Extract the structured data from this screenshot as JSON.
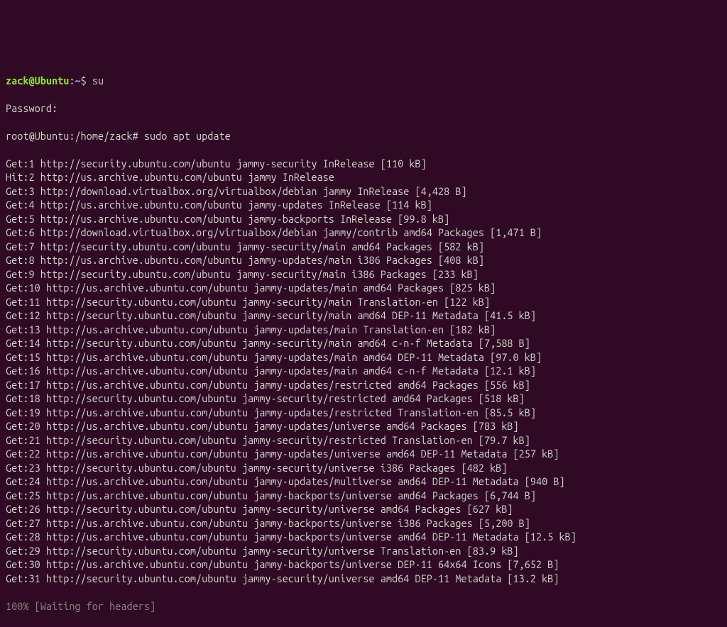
{
  "prompt1": {
    "user": "zack",
    "at": "@",
    "host": "Ubuntu",
    "colon": ":",
    "path": "~",
    "symbol": "$",
    "command": "su"
  },
  "password_prompt": "Password:",
  "prompt2": {
    "text": "root@Ubuntu:/home/zack#",
    "command": "sudo apt update"
  },
  "output_lines": [
    "Get:1 http://security.ubuntu.com/ubuntu jammy-security InRelease [110 kB]",
    "Hit:2 http://us.archive.ubuntu.com/ubuntu jammy InRelease",
    "Get:3 http://download.virtualbox.org/virtualbox/debian jammy InRelease [4,428 B]",
    "Get:4 http://us.archive.ubuntu.com/ubuntu jammy-updates InRelease [114 kB]",
    "Get:5 http://us.archive.ubuntu.com/ubuntu jammy-backports InRelease [99.8 kB]",
    "Get:6 http://download.virtualbox.org/virtualbox/debian jammy/contrib amd64 Packages [1,471 B]",
    "Get:7 http://security.ubuntu.com/ubuntu jammy-security/main amd64 Packages [582 kB]",
    "Get:8 http://us.archive.ubuntu.com/ubuntu jammy-updates/main i386 Packages [408 kB]",
    "Get:9 http://security.ubuntu.com/ubuntu jammy-security/main i386 Packages [233 kB]",
    "Get:10 http://us.archive.ubuntu.com/ubuntu jammy-updates/main amd64 Packages [825 kB]",
    "Get:11 http://security.ubuntu.com/ubuntu jammy-security/main Translation-en [122 kB]",
    "Get:12 http://security.ubuntu.com/ubuntu jammy-security/main amd64 DEP-11 Metadata [41.5 kB]",
    "Get:13 http://us.archive.ubuntu.com/ubuntu jammy-updates/main Translation-en [182 kB]",
    "Get:14 http://security.ubuntu.com/ubuntu jammy-security/main amd64 c-n-f Metadata [7,588 B]",
    "Get:15 http://us.archive.ubuntu.com/ubuntu jammy-updates/main amd64 DEP-11 Metadata [97.0 kB]",
    "Get:16 http://us.archive.ubuntu.com/ubuntu jammy-updates/main amd64 c-n-f Metadata [12.1 kB]",
    "Get:17 http://us.archive.ubuntu.com/ubuntu jammy-updates/restricted amd64 Packages [556 kB]",
    "Get:18 http://security.ubuntu.com/ubuntu jammy-security/restricted amd64 Packages [518 kB]",
    "Get:19 http://us.archive.ubuntu.com/ubuntu jammy-updates/restricted Translation-en [85.5 kB]",
    "Get:20 http://us.archive.ubuntu.com/ubuntu jammy-updates/universe amd64 Packages [783 kB]",
    "Get:21 http://security.ubuntu.com/ubuntu jammy-security/restricted Translation-en [79.7 kB]",
    "Get:22 http://us.archive.ubuntu.com/ubuntu jammy-updates/universe amd64 DEP-11 Metadata [257 kB]",
    "Get:23 http://security.ubuntu.com/ubuntu jammy-security/universe i386 Packages [482 kB]",
    "Get:24 http://us.archive.ubuntu.com/ubuntu jammy-updates/multiverse amd64 DEP-11 Metadata [940 B]",
    "Get:25 http://us.archive.ubuntu.com/ubuntu jammy-backports/universe amd64 Packages [6,744 B]",
    "Get:26 http://security.ubuntu.com/ubuntu jammy-security/universe amd64 Packages [627 kB]",
    "Get:27 http://us.archive.ubuntu.com/ubuntu jammy-backports/universe i386 Packages [5,200 B]",
    "Get:28 http://us.archive.ubuntu.com/ubuntu jammy-backports/universe amd64 DEP-11 Metadata [12.5 kB]",
    "Get:29 http://security.ubuntu.com/ubuntu jammy-security/universe Translation-en [83.9 kB]",
    "Get:30 http://us.archive.ubuntu.com/ubuntu jammy-backports/universe DEP-11 64x64 Icons [7,652 B]",
    "Get:31 http://security.ubuntu.com/ubuntu jammy-security/universe amd64 DEP-11 Metadata [13.2 kB]"
  ],
  "status_line": "100% [Waiting for headers]"
}
